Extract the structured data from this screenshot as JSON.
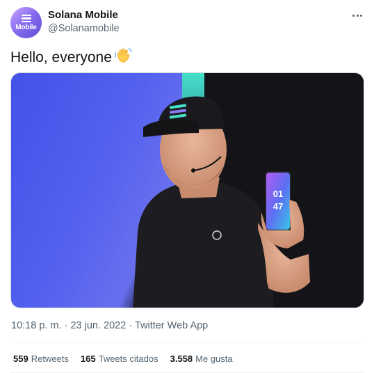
{
  "author": {
    "avatar_text": "Mobile",
    "display_name": "Solana Mobile",
    "handle": "@Solanamobile"
  },
  "tweet": {
    "text": "Hello, everyone",
    "emoji": "waving-hand-icon",
    "media": {
      "phone_screen_digits": [
        "01",
        "47"
      ]
    }
  },
  "meta": {
    "time": "10:18 p. m.",
    "separator": "·",
    "date": "23 jun. 2022",
    "source": "Twitter Web App"
  },
  "stats": [
    {
      "count": "559",
      "label": "Retweets"
    },
    {
      "count": "165",
      "label": "Tweets citados"
    },
    {
      "count": "3.558",
      "label": "Me gusta"
    }
  ],
  "colors": {
    "text_primary": "#0f1419",
    "text_secondary": "#536471",
    "divider": "#eff3f4",
    "avatar_gradient": [
      "#c9a7ff",
      "#5b4fd6"
    ]
  }
}
